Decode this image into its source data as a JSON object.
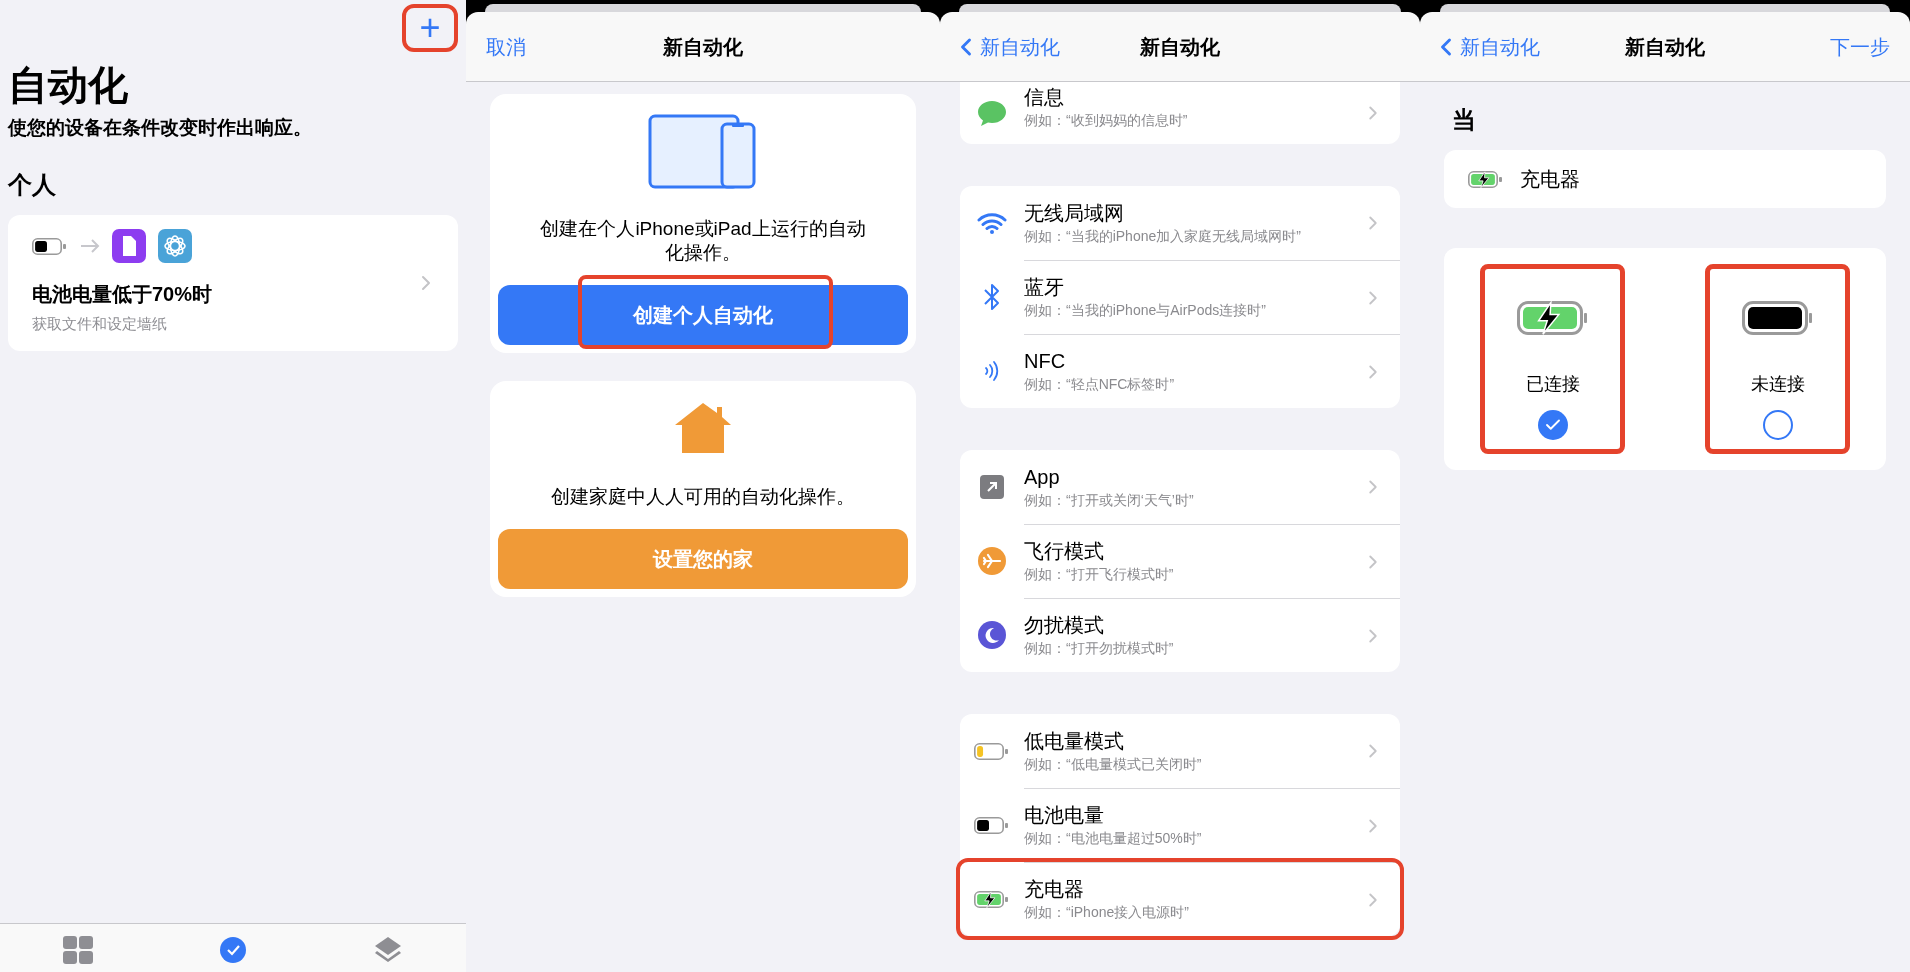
{
  "automation_screen": {
    "add_button": {
      "label": "+",
      "highlighted": true
    },
    "title": "自动化",
    "subtitle": "使您的设备在条件改变时作出响应。",
    "section": "个人",
    "automation": {
      "title": "电池电量低于70%时",
      "subtitle": "获取文件和设定墙纸"
    },
    "tabs": [
      {
        "kind": "shortcuts",
        "selected": false
      },
      {
        "kind": "automation",
        "selected": true
      },
      {
        "kind": "gallery",
        "selected": false
      }
    ]
  },
  "new_automation_screen": {
    "cancel": "取消",
    "title": "新自动化",
    "cards": [
      {
        "kind": "personal",
        "text": "创建在个人iPhone或iPad上运行的自动化操作。",
        "button": "创建个人自动化",
        "highlighted": true
      },
      {
        "kind": "home",
        "text": "创建家庭中人人可用的自动化操作。",
        "button": "设置您的家",
        "highlighted": false
      }
    ]
  },
  "trigger_list_screen": {
    "back": "新自动化",
    "title": "新自动化",
    "groups": [
      [
        {
          "kind": "messages",
          "title": "信息",
          "example": "例如：“收到妈妈的信息时”",
          "highlighted": false
        }
      ],
      [
        {
          "kind": "wifi",
          "title": "无线局域网",
          "example": "例如：“当我的iPhone加入家庭无线局域网时”",
          "highlighted": false
        },
        {
          "kind": "bluetooth",
          "title": "蓝牙",
          "example": "例如：“当我的iPhone与AirPods连接时”",
          "highlighted": false
        },
        {
          "kind": "nfc",
          "title": "NFC",
          "example": "例如：“轻点NFC标签时”",
          "highlighted": false
        }
      ],
      [
        {
          "kind": "app",
          "title": "App",
          "example": "例如：“打开或关闭‘天气’时”",
          "highlighted": false
        },
        {
          "kind": "airplane",
          "title": "飞行模式",
          "example": "例如：“打开飞行模式时”",
          "highlighted": false
        },
        {
          "kind": "focus",
          "title": "勿扰模式",
          "example": "例如：“打开勿扰模式时”",
          "highlighted": false
        }
      ],
      [
        {
          "kind": "low-power",
          "title": "低电量模式",
          "example": "例如：“低电量模式已关闭时”",
          "highlighted": false
        },
        {
          "kind": "battery",
          "title": "电池电量",
          "example": "例如：“电池电量超过50%时”",
          "highlighted": false
        },
        {
          "kind": "charger",
          "title": "充电器",
          "example": "例如：“iPhone接入电源时”",
          "highlighted": true
        }
      ]
    ]
  },
  "charger_screen": {
    "back": "新自动化",
    "title": "新自动化",
    "next": "下一步",
    "section": "当",
    "trigger": "充电器",
    "options": [
      {
        "kind": "connected",
        "label": "已连接",
        "selected": true,
        "highlighted": true
      },
      {
        "kind": "disconnected",
        "label": "未连接",
        "selected": false,
        "highlighted": true
      }
    ]
  }
}
